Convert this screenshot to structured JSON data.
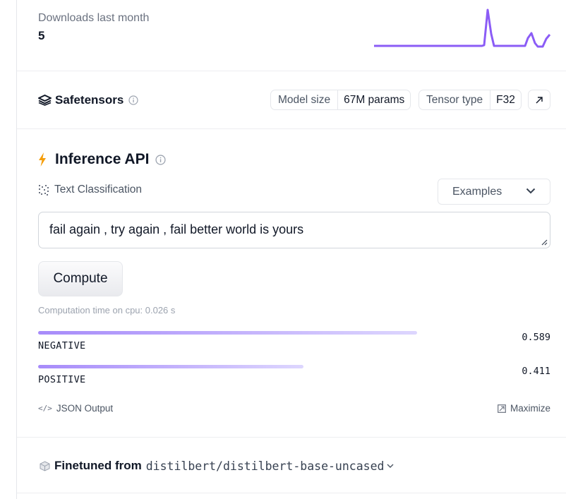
{
  "downloads": {
    "label": "Downloads last month",
    "value": "5"
  },
  "safetensors": {
    "title": "Safetensors",
    "model_size_label": "Model size",
    "model_size_value": "67M params",
    "tensor_type_label": "Tensor type",
    "tensor_type_value": "F32"
  },
  "inference": {
    "title": "Inference API",
    "task": "Text Classification",
    "examples_label": "Examples",
    "input_text": "fail again , try again , fail better world is yours",
    "compute_label": "Compute",
    "computation_time": "Computation time on cpu: 0.026 s",
    "results": [
      {
        "label": "NEGATIVE",
        "score": "0.589"
      },
      {
        "label": "POSITIVE",
        "score": "0.411"
      }
    ],
    "json_output_label": "JSON Output",
    "maximize_label": "Maximize"
  },
  "finetuned": {
    "label": "Finetuned from",
    "model": "distilbert/distilbert-base-uncased"
  },
  "colors": {
    "accent": "#8b5cf6",
    "bar_start": "#a78bfa",
    "bar_end": "#ddd6fe",
    "bolt": "#f59e0b"
  }
}
